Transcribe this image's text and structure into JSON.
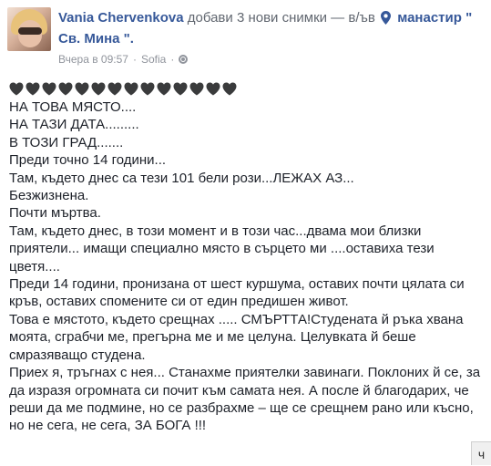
{
  "post": {
    "author": "Vania Chervenkova",
    "action": "добави 3 нови снимки — в/ъв",
    "place_part1": "манастир \"",
    "place_part2": "Св. Мина \".",
    "timestamp": "Вчера в 09:57",
    "location_city": "Sofia",
    "separator": "·",
    "privacy_icon": "globe-icon",
    "location_icon": "pin-icon"
  },
  "hearts": {
    "count": 14,
    "icon": "black-heart-icon",
    "color": "#3a3b3c"
  },
  "body_lines": [
    "НА ТОВА МЯСТО....",
    "НА ТАЗИ ДАТА.........",
    "В ТОЗИ ГРАД.......",
    "Преди точно 14 години...",
    "Там, където днес са тези 101 бели рози...ЛЕЖАХ АЗ...",
    "Безжизнена.",
    "Почти мъртва.",
    "Там, където днес, в този момент и в този час...двама мои близки",
    "приятели... имащи специално място в сърцето ми ....оставиха тези",
    "цветя....",
    "Преди 14 години, пронизана от шест куршума, оставих почти цялата си",
    "кръв, оставих спомените си от един предишен живот.",
    "Това е мястото, където срещнах ..... СМЪРТТА!Студената й ръка хвана",
    "моята, сграбчи ме, прегърна ме и ме целуна. Целувката й беше",
    "смразяващо студена.",
    "Приех я, тръгнах с нея... Станахме приятелки завинаги. Поклоних й се, за",
    "да изразя огромната си почит към самата нея. А после й благодарих, че",
    "реши да ме подмине, но се разбрахме – ще се срещнем рано или късно,",
    "но не сега, не сега, ЗА БОГА !!!"
  ],
  "edge_tab": {
    "label": "ч"
  }
}
